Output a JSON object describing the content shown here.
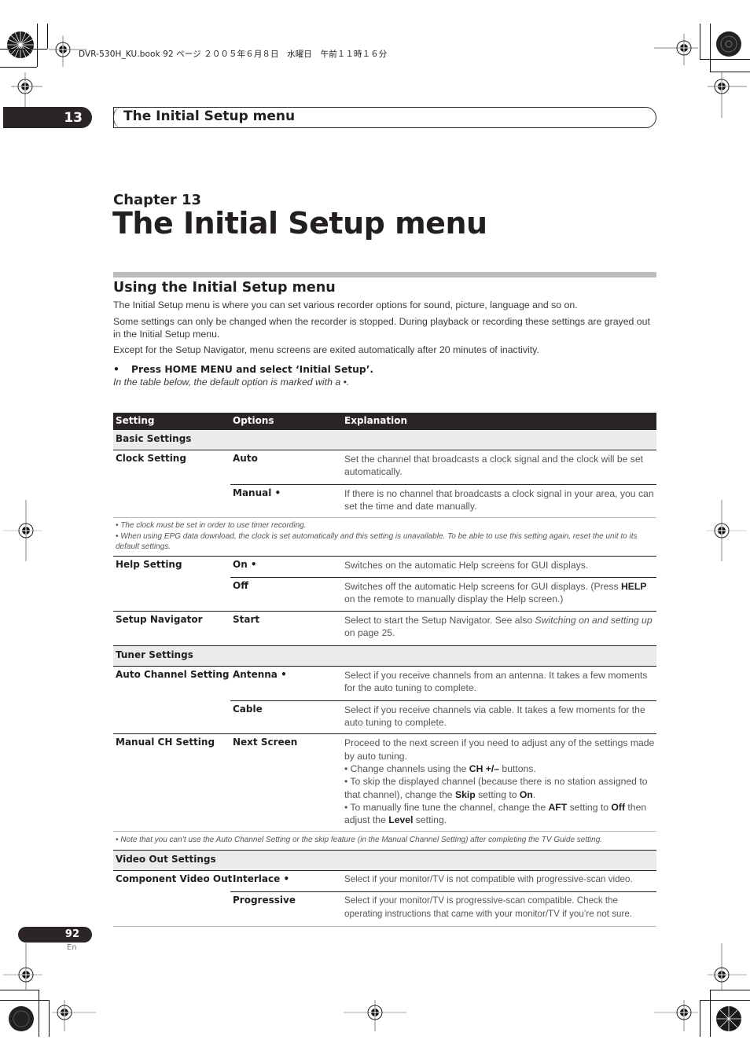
{
  "print_header": {
    "book_info": "DVR-530H_KU.book  92 ページ  ２００５年６月８日　水曜日　午前１１時１６分"
  },
  "chapter_tab": {
    "number": "13",
    "title": "The Initial Setup menu"
  },
  "chapter": {
    "label": "Chapter 13",
    "title": "The Initial Setup menu"
  },
  "section": {
    "title": "Using the Initial Setup menu",
    "paragraphs": [
      "The Initial Setup menu is where you can set various recorder options for sound, picture, language and so on.",
      "Some settings can only be changed when the recorder is stopped. During playback or recording these settings are grayed out in the Initial Setup menu.",
      "Except for the Setup Navigator, menu screens are exited automatically after 20 minutes of inactivity."
    ],
    "step_bullet": "•",
    "step": "Press HOME MENU and select ‘Initial Setup’.",
    "default_note": "In the table below, the default option is marked with a •."
  },
  "table": {
    "headers": {
      "setting": "Setting",
      "options": "Options",
      "explanation": "Explanation"
    },
    "groups": [
      {
        "title": "Basic Settings",
        "settings": [
          {
            "name": "Clock Setting",
            "options": [
              {
                "name": "Auto",
                "explanation": "Set the channel that broadcasts a clock signal and the clock will be set automatically."
              },
              {
                "name": "Manual •",
                "explanation": "If there is no channel that broadcasts a clock signal in your area, you can set the time and date manually."
              }
            ],
            "footnotes": [
              "• The clock must be set in order to use timer recording.",
              "• When using EPG data download, the clock is set automatically and this setting is unavailable. To be able to use this setting again, reset the unit to its default settings."
            ]
          },
          {
            "name": "Help Setting",
            "options": [
              {
                "name": "On •",
                "explanation": "Switches on the automatic Help screens for GUI displays."
              },
              {
                "name": "Off",
                "explanation_parts": [
                  "Switches off the automatic Help screens for GUI displays. (Press ",
                  "HELP",
                  " on the remote to manually display the Help screen.)"
                ]
              }
            ]
          },
          {
            "name": "Setup Navigator",
            "options": [
              {
                "name": "Start",
                "explanation_parts": [
                  "Select to start the Setup Navigator. See also ",
                  "Switching on and setting up",
                  " on page 25."
                ]
              }
            ]
          }
        ]
      },
      {
        "title": "Tuner Settings",
        "settings": [
          {
            "name": "Auto Channel Setting",
            "options": [
              {
                "name": "Antenna •",
                "explanation": "Select if you receive channels from an antenna. It takes a few moments for the auto tuning to complete."
              },
              {
                "name": "Cable",
                "explanation": "Select if you receive channels via cable. It takes a few moments for the auto tuning to complete."
              }
            ]
          },
          {
            "name": "Manual CH Setting",
            "options": [
              {
                "name": "Next Screen",
                "explanation_intro": "Proceed to the next screen if you need to adjust any of the settings made by auto tuning.",
                "bullets": [
                  [
                    "• Change channels using the ",
                    "CH +/–",
                    " buttons."
                  ],
                  [
                    "• To skip the displayed channel (because there is no station assigned to that channel), change the ",
                    "Skip",
                    " setting to ",
                    "On",
                    "."
                  ],
                  [
                    "• To manually fine tune the channel, change the ",
                    "AFT",
                    " setting to ",
                    "Off",
                    " then adjust the ",
                    "Level",
                    " setting."
                  ]
                ]
              }
            ],
            "footnotes": [
              "• Note that you can’t use the Auto Channel Setting or the skip feature (in the Manual Channel Setting) after completing the TV Guide setting."
            ]
          }
        ]
      },
      {
        "title": "Video Out Settings",
        "settings": [
          {
            "name": "Component Video Out",
            "options": [
              {
                "name": "Interlace •",
                "explanation": "Select if your monitor/TV is not compatible with progressive-scan video."
              },
              {
                "name": "Progressive",
                "explanation": "Select if your monitor/TV is progressive-scan compatible. Check the operating instructions that came with your monitor/TV if you’re not sure."
              }
            ]
          }
        ]
      }
    ]
  },
  "page": {
    "number": "92",
    "language": "En"
  },
  "colors": {
    "dark": "#2b2526",
    "group_bg": "#ebebeb",
    "rule_gray": "#bcbcbc"
  }
}
